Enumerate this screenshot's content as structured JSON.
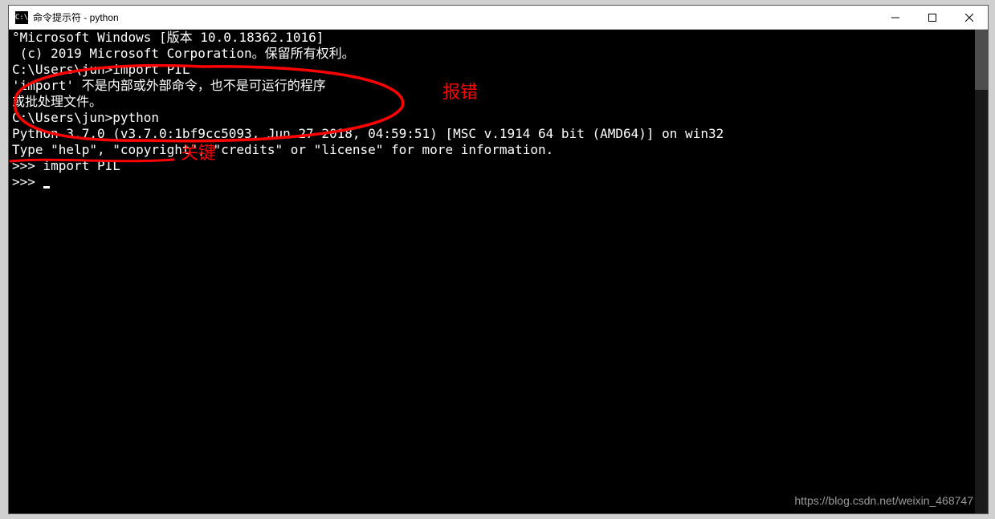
{
  "window": {
    "title": "命令提示符 - python",
    "icon_label": "cmd-icon"
  },
  "terminal": {
    "lines": {
      "l0": "°Microsoft Windows [版本 10.0.18362.1016]",
      "l1": " (c) 2019 Microsoft Corporation。保留所有权利。",
      "l2": "",
      "l3": "C:\\Users\\jun>import PIL",
      "l4": "'import' 不是内部或外部命令，也不是可运行的程序",
      "l5": "或批处理文件。",
      "l6": "",
      "l7": "C:\\Users\\jun>python",
      "l8": "Python 3.7.0 (v3.7.0:1bf9cc5093, Jun 27 2018, 04:59:51) [MSC v.1914 64 bit (AMD64)] on win32",
      "l9": "Type \"help\", \"copyright\", \"credits\" or \"license\" for more information.",
      "l10": ">>> import PIL",
      "l11": ">>> "
    }
  },
  "annotations": {
    "error_label": "报错",
    "key_label": "关键"
  },
  "watermark": "https://blog.csdn.net/weixin_468747"
}
